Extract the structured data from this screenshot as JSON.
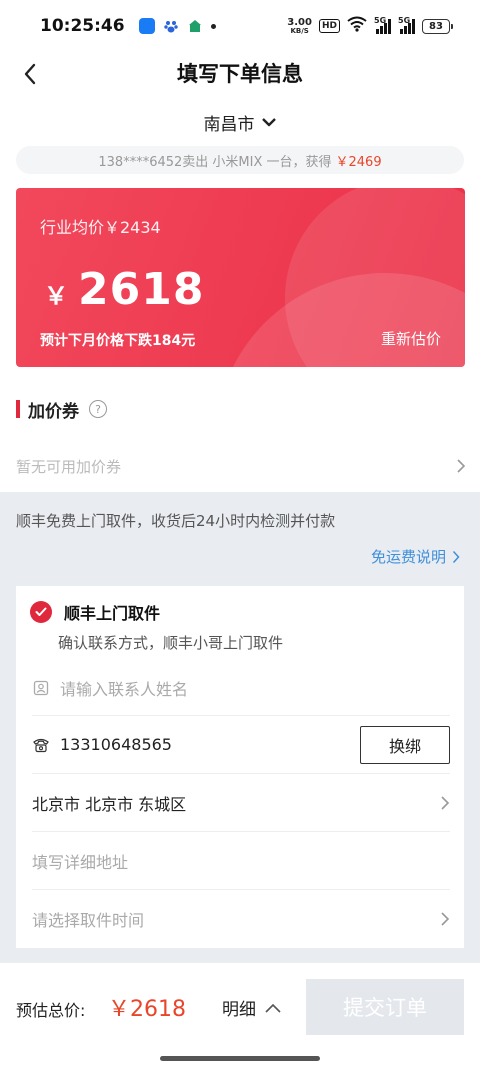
{
  "status_bar": {
    "time": "10:25:46",
    "net_speed_value": "3.00",
    "net_speed_unit": "KB/S",
    "hd_badge": "HD",
    "signal1_type": "5G",
    "signal2_type": "5G",
    "battery": "83"
  },
  "header": {
    "title": "填写下单信息"
  },
  "city": {
    "name": "南昌市"
  },
  "sold_banner": {
    "text": "138****6452卖出 小米MIX 一台，获得",
    "price": "￥2469"
  },
  "price_card": {
    "industry_avg": "行业均价￥2434",
    "currency": "￥",
    "price": "2618",
    "next_month_note": "预计下月价格下跌184元",
    "reestimate_label": "重新估价"
  },
  "coupon": {
    "title": "加价券",
    "help_symbol": "?",
    "empty_text": "暂无可用加价券"
  },
  "shipping": {
    "description": "顺丰免费上门取件，收货后24小时内检测并付款",
    "free_shipping_link": "免运费说明"
  },
  "pickup": {
    "option_label": "顺丰上门取件",
    "option_desc": "确认联系方式，顺丰小哥上门取件",
    "contact_name_placeholder": "请输入联系人姓名",
    "phone": "13310648565",
    "rebind_label": "换绑",
    "region": "北京市 北京市 东城区",
    "address_placeholder": "填写详细地址",
    "pickup_time_placeholder": "请选择取件时间"
  },
  "bottom_bar": {
    "total_label": "预估总价:",
    "total_price": "￥2618",
    "details_label": "明细",
    "submit_label": "提交订单"
  },
  "colors": {
    "accent_red": "#e0283c",
    "price_orange": "#e8462a",
    "link_blue": "#3f8fd9",
    "submit_disabled": "#e4e7ec"
  }
}
